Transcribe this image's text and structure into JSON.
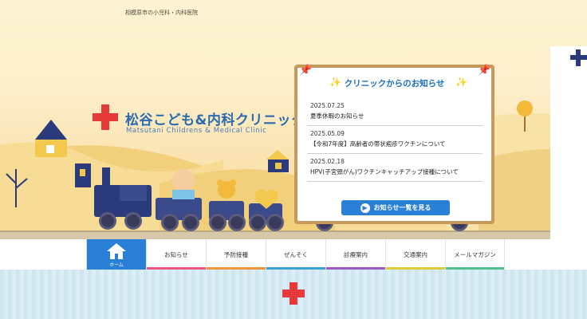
{
  "header": {
    "tagline": "相模原市の小児科・内科医院"
  },
  "logo": {
    "name_jp": "松谷こども&内科クリニック",
    "name_en": "Matsutani Childrens & Medical Clinic"
  },
  "notice": {
    "title": "クリニックからのお知らせ",
    "items": [
      {
        "date": "2025.07.25",
        "text": "夏季休暇のお知らせ"
      },
      {
        "date": "2025.05.09",
        "text": "【令和7年度】高齢者の帯状疱疹ワクチンについて"
      },
      {
        "date": "2025.02.18",
        "text": "HPV(子宮頸がん)ワクチンキャッチアップ接種について"
      }
    ],
    "more_label": "お知らせ一覧を見る"
  },
  "nav": {
    "home_label": "ホーム",
    "items": [
      {
        "label": "お知らせ",
        "color": "#e9557f"
      },
      {
        "label": "予防接種",
        "color": "#f0963a"
      },
      {
        "label": "ぜんそく",
        "color": "#3aa0d6"
      },
      {
        "label": "診療案内",
        "color": "#9b5ac8"
      },
      {
        "label": "交通案内",
        "color": "#e0c93a"
      },
      {
        "label": "メールマガジン",
        "color": "#4cbf8a"
      }
    ]
  },
  "colors": {
    "accent_blue": "#2a7fd6",
    "cross_red": "#e53a3a",
    "board_frame": "#c59a5a"
  }
}
